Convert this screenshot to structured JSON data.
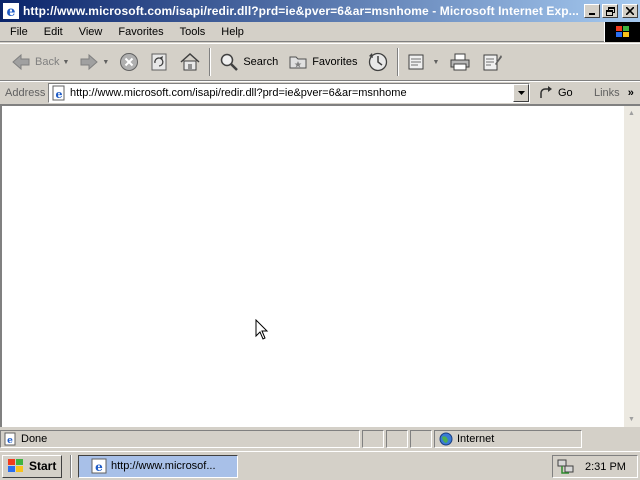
{
  "window": {
    "title": "http://www.microsoft.com/isapi/redir.dll?prd=ie&pver=6&ar=msnhome - Microsoft Internet Exp...",
    "title_color_start": "#0a246a",
    "title_color_end": "#a6caf0"
  },
  "menu": [
    "File",
    "Edit",
    "View",
    "Favorites",
    "Tools",
    "Help"
  ],
  "toolbar": {
    "back_label": "Back",
    "search_label": "Search",
    "favorites_label": "Favorites"
  },
  "address": {
    "label": "Address",
    "url": "http://www.microsoft.com/isapi/redir.dll?prd=ie&pver=6&ar=msnhome",
    "go_label": "Go",
    "links_label": "Links"
  },
  "status": {
    "text": "Done",
    "zone": "Internet"
  },
  "taskbar": {
    "start_label": "Start",
    "task_label": "http://www.microsof...",
    "clock": "2:31 PM"
  }
}
